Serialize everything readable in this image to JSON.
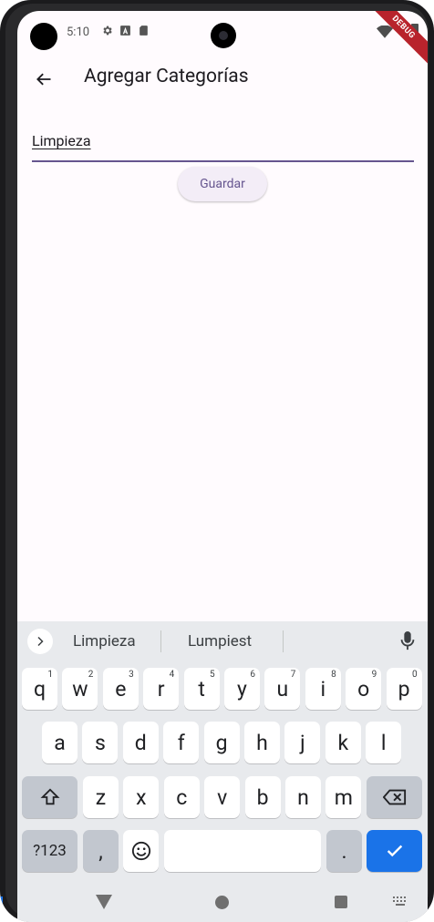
{
  "status_bar": {
    "time": "5:10",
    "icons": [
      "gear-icon",
      "a-icon",
      "sd-card-icon",
      "wifi-icon",
      "battery-icon"
    ]
  },
  "debug_banner": "DEBUG",
  "app_bar": {
    "title": "Agregar Categorías",
    "back_icon": "arrow-back-icon"
  },
  "form": {
    "input_value": "Limpieza",
    "save_label": "Guardar"
  },
  "keyboard": {
    "suggestions": [
      "Limpieza",
      "Lumpiest"
    ],
    "row1": [
      {
        "k": "q",
        "n": "1"
      },
      {
        "k": "w",
        "n": "2"
      },
      {
        "k": "e",
        "n": "3"
      },
      {
        "k": "r",
        "n": "4"
      },
      {
        "k": "t",
        "n": "5"
      },
      {
        "k": "y",
        "n": "6"
      },
      {
        "k": "u",
        "n": "7"
      },
      {
        "k": "i",
        "n": "8"
      },
      {
        "k": "o",
        "n": "9"
      },
      {
        "k": "p",
        "n": "0"
      }
    ],
    "row2": [
      "a",
      "s",
      "d",
      "f",
      "g",
      "h",
      "j",
      "k",
      "l"
    ],
    "row3": [
      "z",
      "x",
      "c",
      "v",
      "b",
      "n",
      "m"
    ],
    "symbols_label": "?123",
    "comma": ",",
    "period": ".",
    "colors": {
      "action": "#1a73e8",
      "function_key": "#c2c7cf",
      "key": "#ffffff",
      "background": "#e8eaed"
    }
  },
  "theme": {
    "accent": "#65558f",
    "surface": "#fffbfe",
    "button_bg": "#f3edf7"
  }
}
